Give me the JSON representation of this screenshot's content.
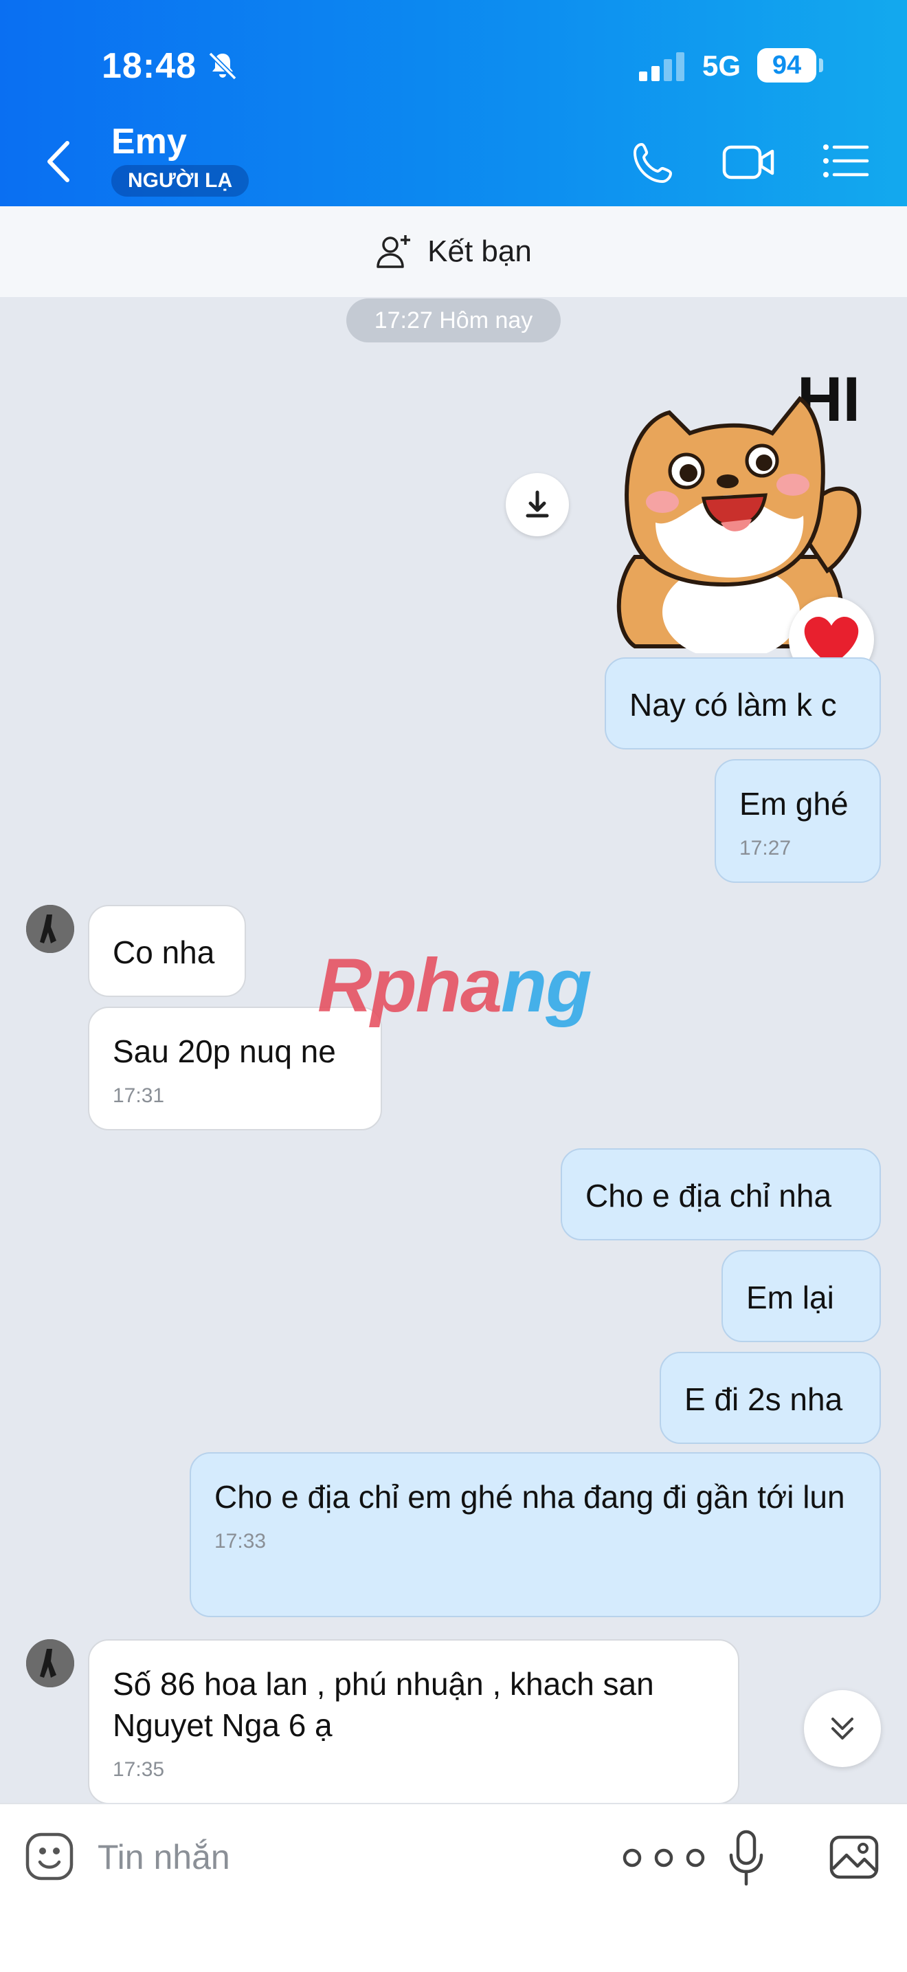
{
  "status_bar": {
    "time": "18:48",
    "network": "5G",
    "battery": "94"
  },
  "header": {
    "contact_name": "Emy",
    "badge": "NGƯỜI LẠ"
  },
  "friend_bar": {
    "label": "Kết bạn"
  },
  "chat": {
    "date_divider": "17:27 Hôm nay",
    "sticker_text": "HI",
    "messages": [
      {
        "dir": "out",
        "text": "Nay có làm k c"
      },
      {
        "dir": "out",
        "text": "Em ghé",
        "time": "17:27"
      },
      {
        "dir": "in",
        "text": "Co nha"
      },
      {
        "dir": "in",
        "text": "Sau 20p nuq ne",
        "time": "17:31"
      },
      {
        "dir": "out",
        "text": "Cho e địa chỉ nha"
      },
      {
        "dir": "out",
        "text": "Em lại"
      },
      {
        "dir": "out",
        "text": "E đi 2s nha"
      },
      {
        "dir": "out",
        "text": "Cho e địa chỉ em ghé nha đang đi gần tới lun",
        "time": "17:33"
      },
      {
        "dir": "in",
        "text": "Số 86 hoa lan , phú nhuận , khach san Nguyet Nga 6 ạ",
        "time": "17:35"
      }
    ]
  },
  "watermark": {
    "part1": "Rpha",
    "part2": "ng"
  },
  "input_bar": {
    "placeholder": "Tin nhắn"
  },
  "icons": {
    "back": "chevron-left-icon",
    "phone": "phone-icon",
    "video": "video-icon",
    "menu": "list-menu-icon",
    "add_friend": "add-user-icon",
    "download": "download-icon",
    "reaction": "heart-icon",
    "emoji": "emoji-icon",
    "more": "more-icon",
    "mic": "mic-icon",
    "image": "image-icon",
    "scroll": "chevron-double-down-icon"
  },
  "colors": {
    "header_start": "#0a6ff2",
    "header_end": "#13a9ee",
    "outgoing_bubble": "#d5ebfd",
    "incoming_bubble": "#ffffff",
    "heart": "#e8202e"
  }
}
